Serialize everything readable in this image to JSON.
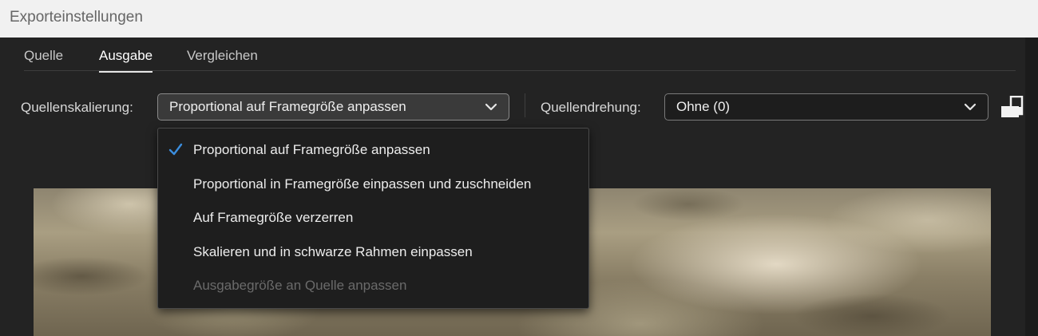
{
  "window": {
    "title": "Exporteinstellungen"
  },
  "tabs": [
    {
      "label": "Quelle",
      "active": false
    },
    {
      "label": "Ausgabe",
      "active": true
    },
    {
      "label": "Vergleichen",
      "active": false
    }
  ],
  "scaling": {
    "label": "Quellenskalierung:",
    "value": "Proportional auf Framegröße anpassen",
    "open": true,
    "options": [
      {
        "label": "Proportional auf Framegröße anpassen",
        "checked": true,
        "disabled": false
      },
      {
        "label": "Proportional in Framegröße einpassen und zuschneiden",
        "checked": false,
        "disabled": false
      },
      {
        "label": "Auf Framegröße verzerren",
        "checked": false,
        "disabled": false
      },
      {
        "label": "Skalieren und in schwarze Rahmen einpassen",
        "checked": false,
        "disabled": false
      },
      {
        "label": "Ausgabegröße an Quelle anpassen",
        "checked": false,
        "disabled": true
      }
    ]
  },
  "rotation": {
    "label": "Quellendrehung:",
    "value": "Ohne (0)"
  },
  "icons": {
    "chevron": "chevron-down-icon",
    "check": "checkmark-icon",
    "rotate": "rotate-icon"
  },
  "colors": {
    "accent": "#3b8ddd",
    "background": "#232323",
    "titlebar": "#f1f1f1"
  }
}
